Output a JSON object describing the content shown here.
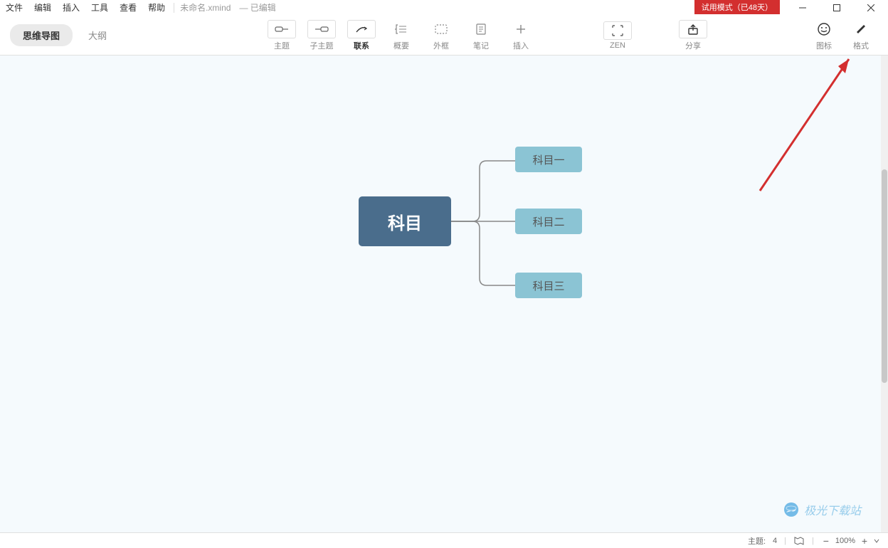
{
  "menu": {
    "file": "文件",
    "edit": "编辑",
    "insert": "插入",
    "tools": "工具",
    "view": "查看",
    "help": "帮助"
  },
  "document": {
    "title": "未命名.xmind",
    "status": "— 已编辑"
  },
  "trial": "试用模式（已48天）",
  "viewTabs": {
    "mindmap": "思维导图",
    "outline": "大纲"
  },
  "tools": {
    "topic": "主题",
    "subtopic": "子主题",
    "relation": "联系",
    "summary": "概要",
    "boundary": "外框",
    "note": "笔记",
    "insert": "插入",
    "zen": "ZEN",
    "share": "分享",
    "iconLib": "图标",
    "format": "格式"
  },
  "mindmap": {
    "central": "科目",
    "nodes": [
      "科目一",
      "科目二",
      "科目三"
    ]
  },
  "statusbar": {
    "topicLabel": "主题:",
    "topicCount": "4",
    "zoomValue": "100%"
  },
  "watermark": "极光下载站"
}
